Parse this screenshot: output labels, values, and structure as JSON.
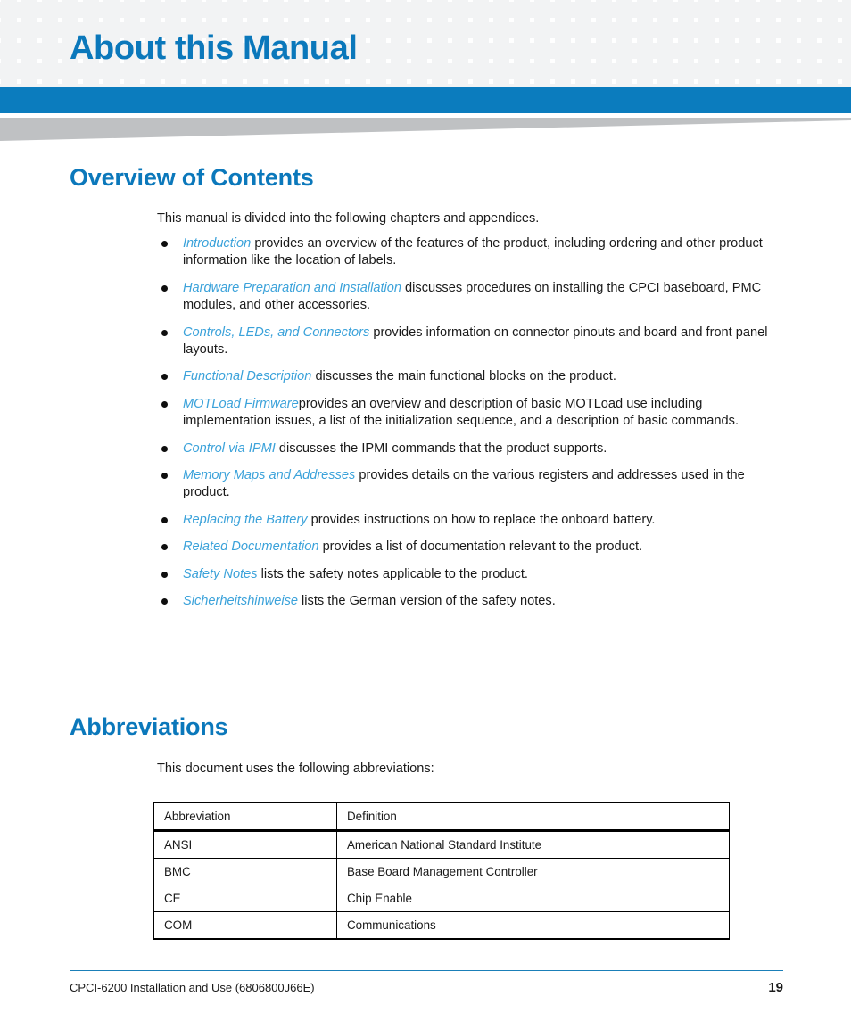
{
  "header": {
    "title": "About this Manual",
    "accent_color": "#0b7cbe",
    "title_color": "#0b78bb",
    "grid_cell_color": "#f2f3f4",
    "wedge_color": "#bfc1c3"
  },
  "overview": {
    "heading": "Overview of Contents",
    "intro": "This manual is divided into the following chapters and appendices.",
    "link_color": "#3ba2da",
    "bullets": [
      {
        "xref": "Introduction",
        "text": " provides an overview of the features of the product, including ordering and other product information like the location of labels."
      },
      {
        "xref": "Hardware Preparation and Installation",
        "text": " discusses procedures on installing the CPCI baseboard, PMC modules, and other accessories."
      },
      {
        "xref": "Controls, LEDs, and Connectors",
        "text": " provides information on connector pinouts and board and front panel layouts."
      },
      {
        "xref": "Functional Description",
        "text": " discusses the main functional blocks on the product."
      },
      {
        "xref": "MOTLoad Firmware",
        "text": "provides an overview and description of basic MOTLoad use including implementation issues, a list of the initialization sequence, and a description of basic commands."
      },
      {
        "xref": "Control via IPMI",
        "text": " discusses the IPMI commands that the product supports."
      },
      {
        "xref": "Memory Maps and Addresses",
        "text": " provides details on the various registers and addresses used in the product."
      },
      {
        "xref": "Replacing the Battery",
        "text": " provides instructions on how to replace the onboard battery."
      },
      {
        "xref": "Related Documentation",
        "text": " provides a list of documentation relevant to the product."
      },
      {
        "xref": "Safety Notes",
        "text": " lists the safety notes applicable to the product."
      },
      {
        "xref": "Sicherheitshinweise",
        "text": " lists the German version of the safety notes."
      }
    ]
  },
  "abbreviations": {
    "heading": "Abbreviations",
    "intro": "This document uses the following abbreviations:",
    "table": {
      "columns": [
        "Abbreviation",
        "Definition"
      ],
      "rows": [
        [
          "ANSI",
          "American National Standard Institute"
        ],
        [
          "BMC",
          "Base Board Management Controller"
        ],
        [
          "CE",
          "Chip Enable"
        ],
        [
          "COM",
          "Communications"
        ]
      ]
    }
  },
  "footer": {
    "document": "CPCI-6200 Installation and Use (6806800J66E)",
    "page_number": "19",
    "rule_color": "#1a7fb8"
  }
}
